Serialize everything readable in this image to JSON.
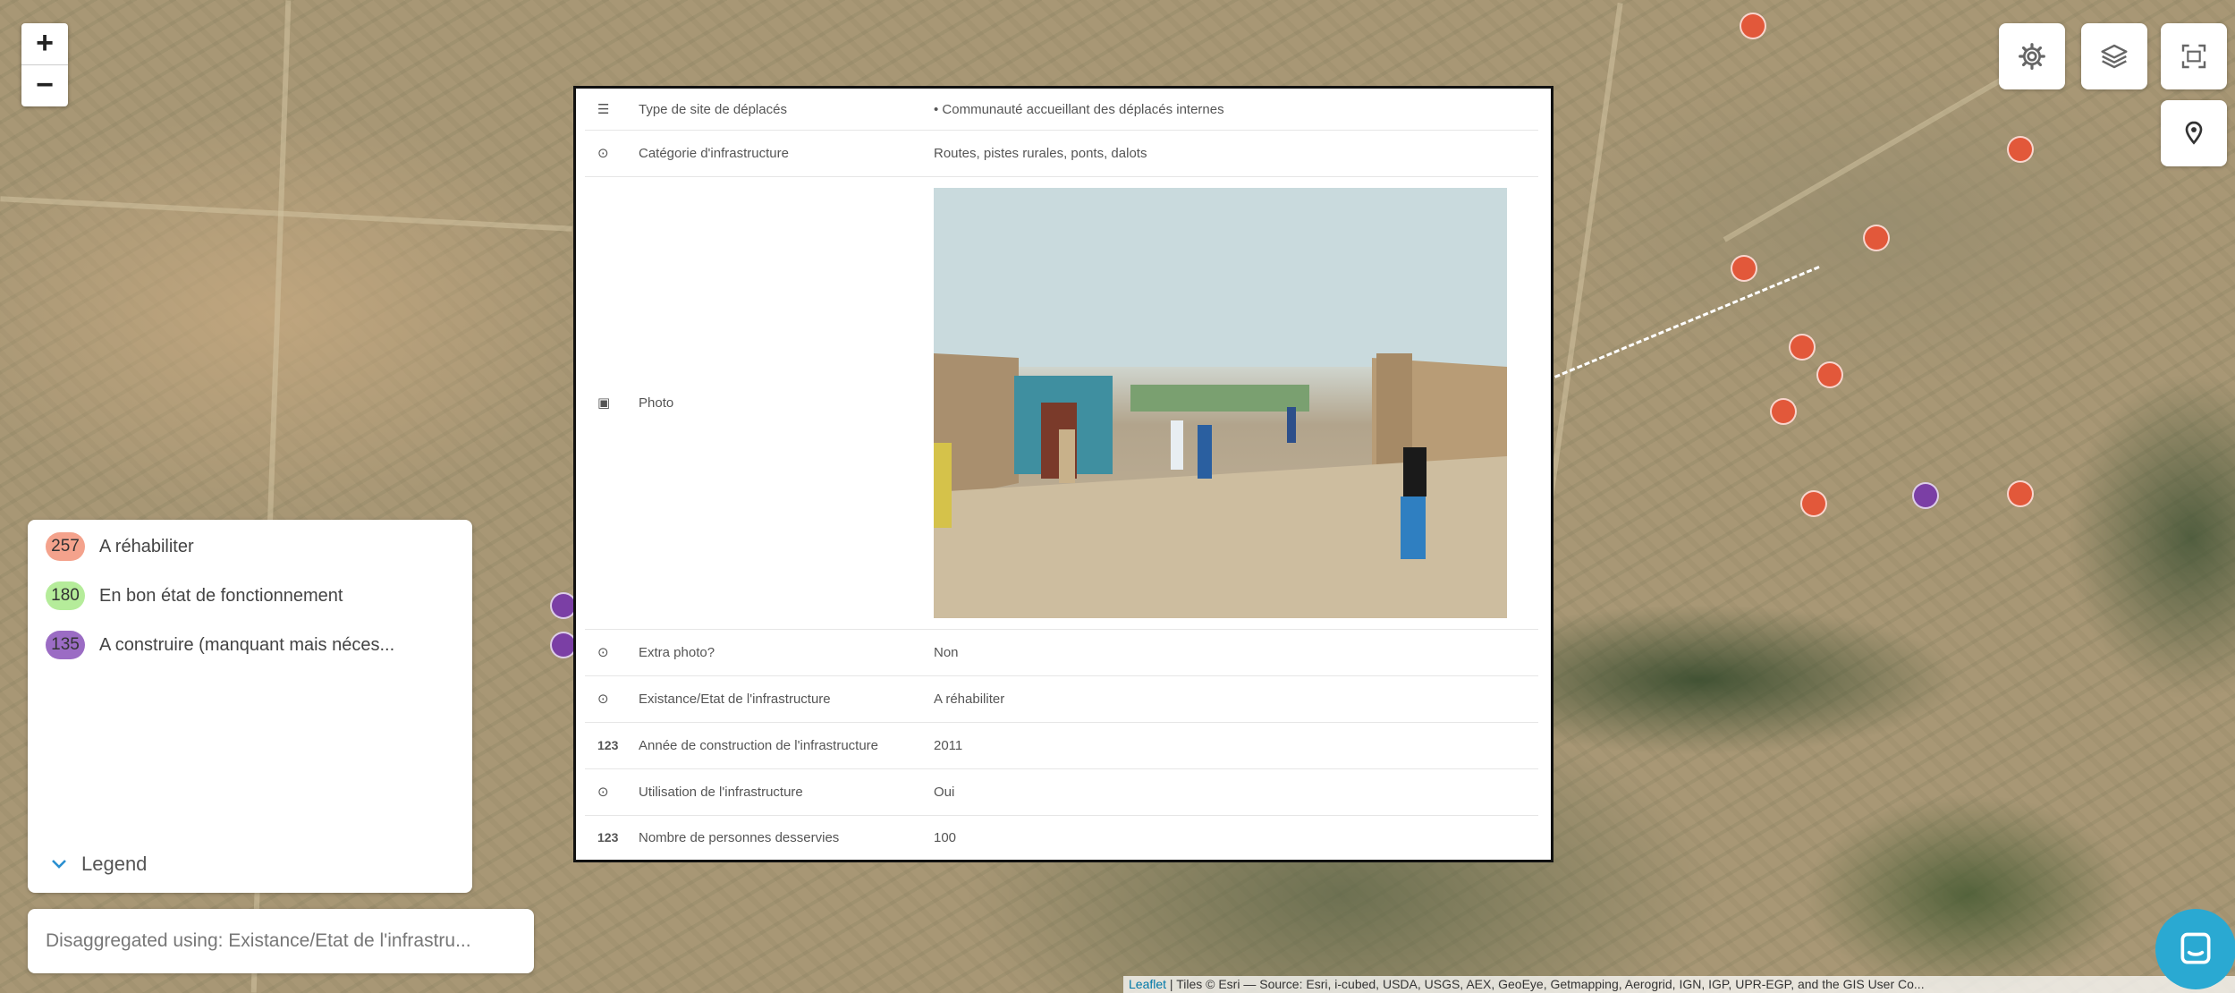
{
  "zoom": {
    "in_label": "+",
    "out_label": "−"
  },
  "top_right_buttons": [
    {
      "icon": "gear-icon"
    },
    {
      "icon": "layers-icon"
    },
    {
      "icon": "fullscreen-icon"
    },
    {
      "icon": "map-pin-icon"
    }
  ],
  "popup": {
    "rows": [
      {
        "icon": "list-icon",
        "icon_glyph": "☰",
        "label": "Type de site de déplacés",
        "value": "• Communauté accueillant des déplacés internes"
      },
      {
        "icon": "radio-icon",
        "icon_glyph": "⊙",
        "label": "Catégorie d'infrastructure",
        "value": "Routes, pistes rurales, ponts, dalots"
      },
      {
        "icon": "image-icon",
        "icon_glyph": "▣",
        "label": "Photo",
        "value": ""
      },
      {
        "icon": "radio-icon",
        "icon_glyph": "⊙",
        "label": "Extra photo?",
        "value": "Non"
      },
      {
        "icon": "radio-icon",
        "icon_glyph": "⊙",
        "label": "Existance/Etat de l'infrastructure",
        "value": "A réhabiliter"
      },
      {
        "icon": "number-icon",
        "icon_glyph": "123",
        "label": "Année de construction de l'infrastructure",
        "value": "2011"
      },
      {
        "icon": "radio-icon",
        "icon_glyph": "⊙",
        "label": "Utilisation de l'infrastructure",
        "value": "Oui"
      },
      {
        "icon": "number-icon",
        "icon_glyph": "123",
        "label": "Nombre de personnes desservies",
        "value": "100"
      }
    ]
  },
  "legend": {
    "items": [
      {
        "count": "257",
        "label": "A réhabiliter",
        "color": "#f4a28c"
      },
      {
        "count": "180",
        "label": "En bon état de fonctionnement",
        "color": "#b5ec9a"
      },
      {
        "count": "135",
        "label": "A construire (manquant mais néces...",
        "color": "#9b6cc4"
      }
    ],
    "toggle_label": "Legend"
  },
  "disaggregation": {
    "text": "Disaggregated using: Existance/Etat de l'infrastru..."
  },
  "attribution": {
    "leaflet": "Leaflet",
    "text": " | Tiles © Esri — Source: Esri, i-cubed, USDA, USGS, AEX, GeoEye, Getmapping, Aerogrid, IGN, IGP, UPR-EGP, and the GIS User Co..."
  },
  "colors": {
    "rehab": "#e2583a",
    "construct": "#7b3fa5",
    "chat": "#2aa9d2"
  }
}
